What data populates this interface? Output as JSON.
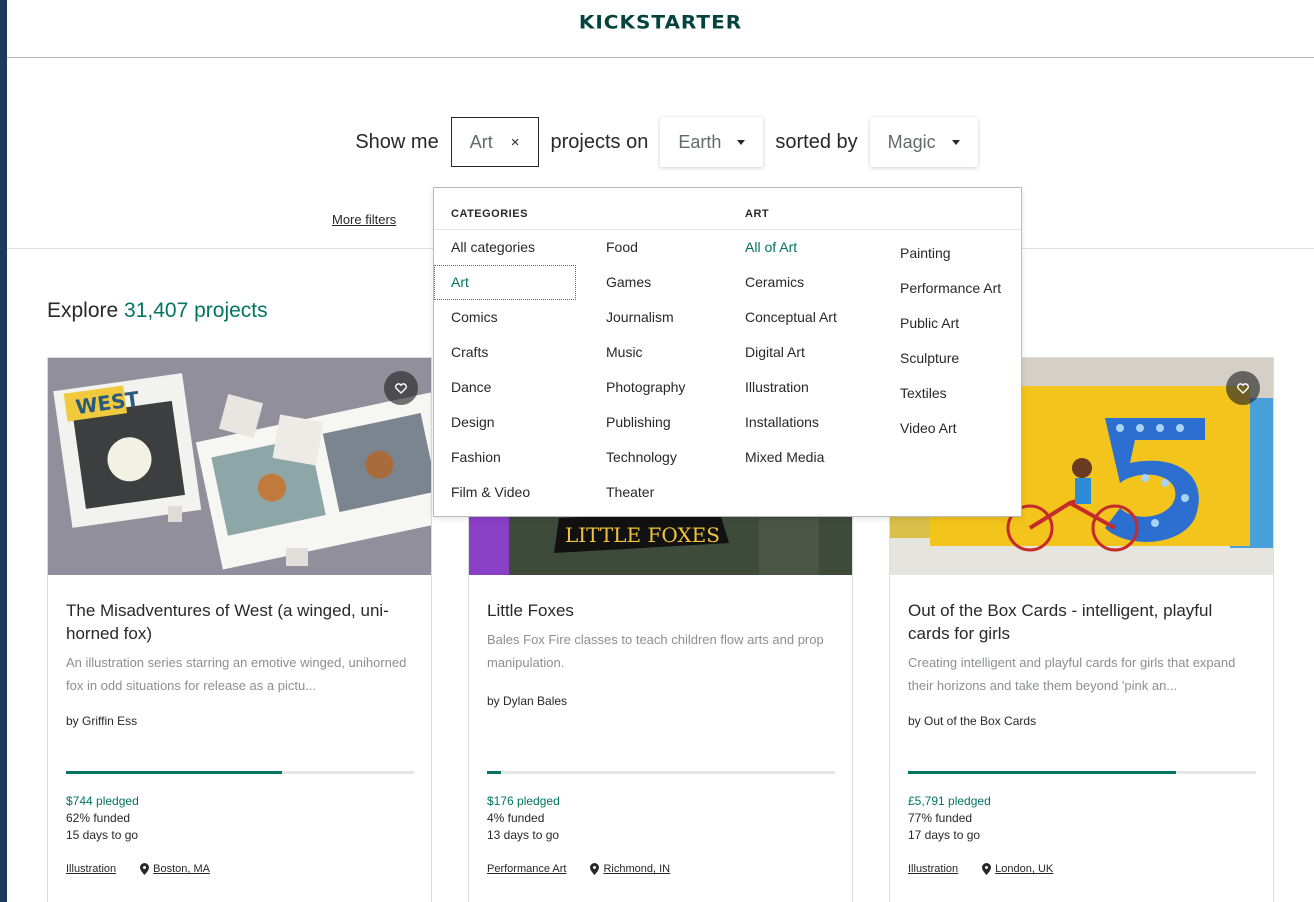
{
  "header": {
    "logo_text": "KICKSTARTER"
  },
  "filters": {
    "show_me": "Show me",
    "category_chip": "Art",
    "clear_glyph": "×",
    "projects_on": "projects on",
    "location": "Earth",
    "sorted_by": "sorted by",
    "sort": "Magic",
    "more_filters": "More filters"
  },
  "explore": {
    "prefix": "Explore",
    "count": "31,407 projects"
  },
  "dropdown": {
    "categories_heading": "CATEGORIES",
    "art_heading": "ART",
    "categories_col1": [
      "All categories",
      "Art",
      "Comics",
      "Crafts",
      "Dance",
      "Design",
      "Fashion",
      "Film & Video"
    ],
    "categories_col2": [
      "Food",
      "Games",
      "Journalism",
      "Music",
      "Photography",
      "Publishing",
      "Technology",
      "Theater"
    ],
    "art_col1": [
      "All of Art",
      "Ceramics",
      "Conceptual Art",
      "Digital Art",
      "Illustration",
      "Installations",
      "Mixed Media"
    ],
    "art_col2": [
      "Painting",
      "Performance Art",
      "Public Art",
      "Sculpture",
      "Textiles",
      "Video Art"
    ],
    "selected_category": "Art"
  },
  "cards": [
    {
      "title": "The Misadventures of West (a winged, uni-horned fox)",
      "blurb": "An illustration series starring an emotive winged, unihorned fox in odd situations for release as a pictu...",
      "creator": "by Griffin Ess",
      "funded_fraction": 0.62,
      "pledged": "$744 pledged",
      "funded": "62% funded",
      "days": "15 days to go",
      "category": "Illustration",
      "location": "Boston, MA"
    },
    {
      "title": "Little Foxes",
      "blurb": "Bales Fox Fire classes to teach children flow arts and prop manipulation.",
      "creator": "by Dylan Bales",
      "funded_fraction": 0.04,
      "pledged": "$176 pledged",
      "funded": "4% funded",
      "days": "13 days to go",
      "category": "Performance Art",
      "location": "Richmond, IN",
      "banner_text": "LITTLE FOXES"
    },
    {
      "title": "Out of the Box Cards - intelligent, playful cards for girls",
      "blurb": "Creating intelligent and playful cards for girls that expand their horizons and take them beyond 'pink an...",
      "creator": "by Out of the Box Cards",
      "funded_fraction": 0.77,
      "pledged": "£5,791 pledged",
      "funded": "77% funded",
      "days": "17 days to go",
      "category": "Illustration",
      "location": "London, UK"
    }
  ],
  "colors": {
    "brand_green": "#037362",
    "logo_green": "#05443e",
    "frame": "#1b3a5e"
  },
  "icons": [
    "heart-icon",
    "close-icon",
    "chevron-down-icon",
    "location-pin-icon"
  ]
}
